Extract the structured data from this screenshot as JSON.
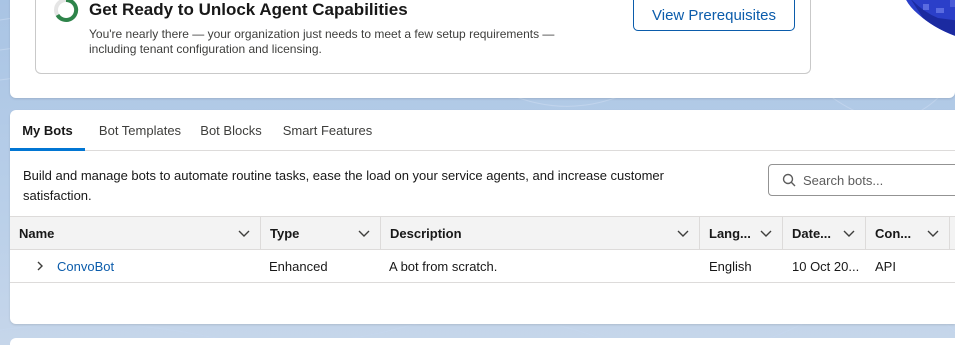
{
  "banner": {
    "title": "Get Ready to Unlock Agent Capabilities",
    "description": "You're nearly there — your organization just needs to meet a few setup requirements — including tenant configuration and licensing.",
    "button_label": "View Prerequisites",
    "progress_color": "#2e844a"
  },
  "tabs": [
    {
      "label": "My Bots",
      "active": true
    },
    {
      "label": "Bot Templates",
      "active": false
    },
    {
      "label": "Bot Blocks",
      "active": false
    },
    {
      "label": "Smart Features",
      "active": false
    }
  ],
  "intro_text": "Build and manage bots to automate routine tasks, ease the load on your service agents, and increase customer satisfaction.",
  "search": {
    "placeholder": "Search bots..."
  },
  "table": {
    "columns": [
      "Name",
      "Type",
      "Description",
      "Lang...",
      "Date...",
      "Con..."
    ],
    "rows": [
      {
        "name": "ConvoBot",
        "type": "Enhanced",
        "description": "A bot from scratch.",
        "language": "English",
        "date": "10 Oct 20...",
        "connection": "API"
      }
    ]
  },
  "colors": {
    "accent": "#0176d3",
    "link": "#0b5cab"
  }
}
